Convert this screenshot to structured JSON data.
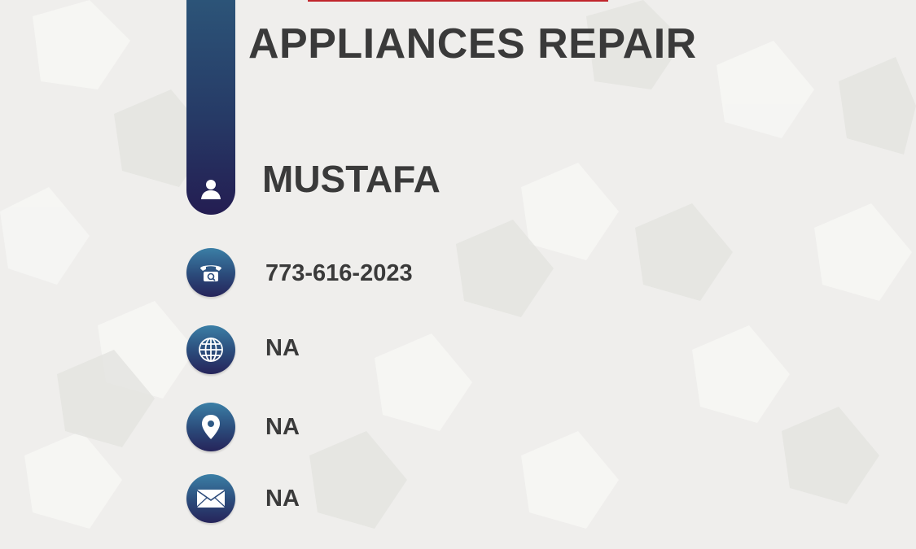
{
  "card": {
    "title": "APPLIANCES REPAIR",
    "name": "MUSTAFA",
    "contacts": [
      {
        "icon": "phone-icon",
        "value": "773-616-2023"
      },
      {
        "icon": "globe-icon",
        "value": "NA"
      },
      {
        "icon": "location-pin-icon",
        "value": "NA"
      },
      {
        "icon": "mail-icon",
        "value": "NA"
      }
    ]
  },
  "colors": {
    "accent_red": "#c0252b",
    "bar_top": "#2c5478",
    "bar_bottom": "#241d52",
    "text": "#3a3a3a"
  }
}
